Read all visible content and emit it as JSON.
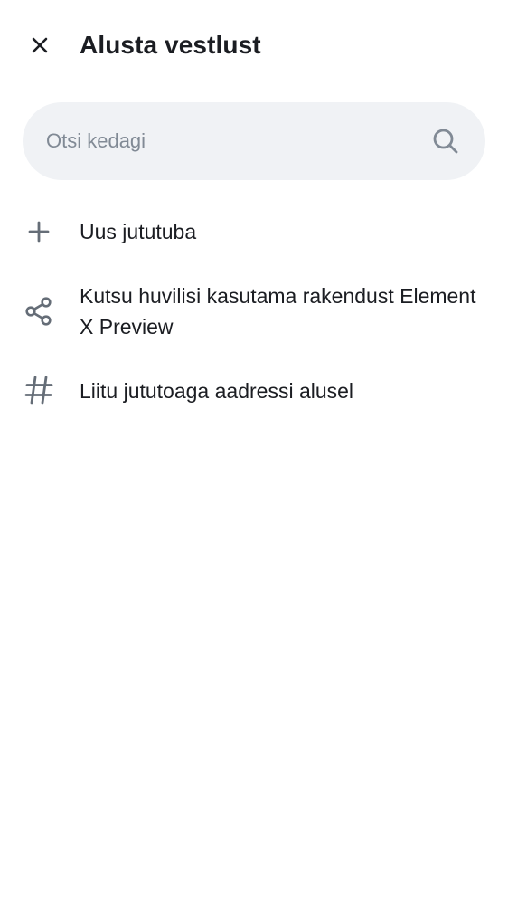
{
  "header": {
    "title": "Alusta vestlust",
    "close_icon": "close-icon"
  },
  "search": {
    "placeholder": "Otsi kedagi",
    "icon": "search-icon"
  },
  "menu": {
    "items": [
      {
        "label": "Uus jututuba",
        "icon": "plus-icon"
      },
      {
        "label": "Kutsu huvilisi kasutama rakendust Element X Preview",
        "icon": "share-icon"
      },
      {
        "label": "Liitu jututoaga aadressi alusel",
        "icon": "hashtag-icon"
      }
    ]
  },
  "colors": {
    "background": "#ffffff",
    "text_primary": "#1b1d22",
    "text_secondary": "#818a95",
    "icon": "#656d77",
    "search_background": "#f0f2f5"
  }
}
